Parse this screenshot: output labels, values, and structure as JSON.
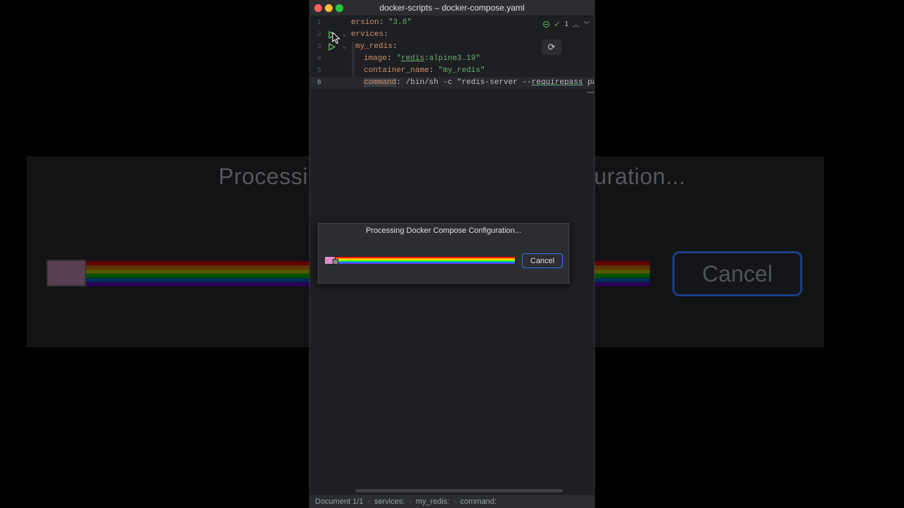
{
  "background": {
    "title": "Processing Docker Compose Configuration...",
    "cancel_label": "Cancel"
  },
  "window": {
    "title": "docker-scripts – docker-compose.yaml"
  },
  "editor": {
    "lines": [
      {
        "num": "1"
      },
      {
        "num": "2"
      },
      {
        "num": "3"
      },
      {
        "num": "4"
      },
      {
        "num": "5"
      },
      {
        "num": "6"
      }
    ],
    "code": {
      "l1_key": "ersion",
      "l1_sep": ": ",
      "l1_val": "\"3.8\"",
      "l2_key": "ervices",
      "l2_sep": ":",
      "l3_key": "my_redis",
      "l3_sep": ":",
      "l4_key": "image",
      "l4_sep": ": ",
      "l4_q1": "\"",
      "l4_u": "redis",
      "l4_rest": ":alpine3.19\"",
      "l5_key": "container_name",
      "l5_sep": ": ",
      "l5_val": "\"my_redis\"",
      "l6_key": "command",
      "l6_sep": ": ",
      "l6_val1": "/bin/sh -c \"redis-server --",
      "l6_u": "requirepass",
      "l6_val2": " passwo"
    },
    "inspection_count": "1"
  },
  "statusbar": {
    "crumbs": [
      "Document 1/1",
      "services:",
      "my_redis:",
      "command:"
    ]
  },
  "dialog": {
    "title": "Processing Docker Compose Configuration...",
    "cancel_label": "Cancel",
    "progress_style": "nyan-cat rainbow (indeterminate)"
  },
  "colors": {
    "accent": "#3574f0",
    "yaml_key": "#cf8e6d",
    "yaml_string": "#6aab73",
    "run_icon": "#5fb865"
  }
}
